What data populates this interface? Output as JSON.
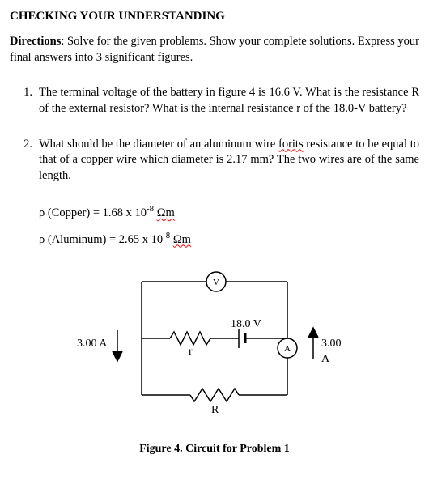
{
  "title": "CHECKING YOUR UNDERSTANDING",
  "directions_label": "Directions",
  "directions_text": ": Solve for the given problems. Show your complete solutions. Express your final answers into 3 significant figures.",
  "problems": [
    {
      "num": "1.",
      "text": "The terminal voltage of the battery in figure 4 is 16.6 V. What is the resistance R of the external resistor? What is the internal resistance r of the 18.0-V battery?"
    },
    {
      "num": "2.",
      "text_pre": "What should be the diameter of an aluminum wire ",
      "text_err": "forits",
      "text_post": " resistance to be equal to that of a copper wire which diameter is 2.17 mm? The two wires are of the same length."
    }
  ],
  "rho_copper_pre": "ρ (Copper) = 1.68 x 10",
  "rho_copper_exp": "-8",
  "rho_copper_unit": "Ωm",
  "rho_alum_pre": "ρ (Aluminum) = 2.65 x 10",
  "rho_alum_exp": "-8",
  "rho_alum_unit": "Ωm",
  "circuit": {
    "left_current": "3.00 A",
    "right_current": "3.00 A",
    "emf": "18.0 V",
    "r_small": "r",
    "R_big": "R",
    "voltmeter": "V",
    "ammeter": "A"
  },
  "caption": "Figure 4. Circuit for Problem 1"
}
